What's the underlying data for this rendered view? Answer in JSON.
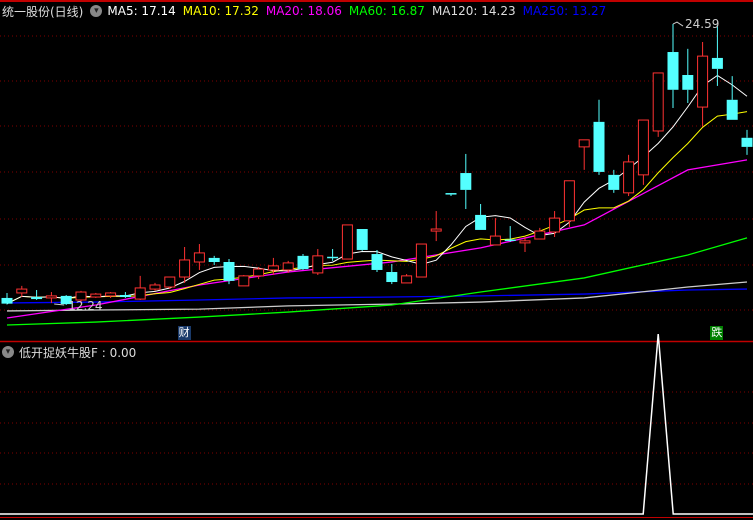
{
  "header": {
    "title": "统一股份(日线)",
    "menu_icon": "chevron-down-circle-icon",
    "ma": [
      {
        "label": "MA5: 17.14",
        "color": "#ffffff"
      },
      {
        "label": "MA10: 17.32",
        "color": "#ffff00"
      },
      {
        "label": "MA20: 18.06",
        "color": "#ff00ff"
      },
      {
        "label": "MA60: 16.87",
        "color": "#00ff00"
      },
      {
        "label": "MA120: 14.23",
        "color": "#dddddd"
      },
      {
        "label": "MA250: 13.27",
        "color": "#0000ff"
      }
    ]
  },
  "indicator": {
    "label": "低开捉妖牛股F : 0.00"
  },
  "markers": {
    "high_label": "24.59",
    "low_label": "12.24",
    "cai": "财",
    "die": "跌"
  },
  "colors": {
    "up": "#ff3232",
    "down": "#54ffff",
    "grid": "#800000",
    "bg": "#000000"
  },
  "chart_data": {
    "type": "candlestick",
    "price_range": [
      11.2,
      25.3
    ],
    "candles": [
      [
        12.55,
        12.77,
        12.26,
        12.3
      ],
      [
        12.77,
        13.08,
        12.59,
        12.94
      ],
      [
        12.59,
        12.9,
        12.46,
        12.5
      ],
      [
        12.55,
        12.81,
        12.33,
        12.64
      ],
      [
        12.64,
        12.68,
        12.24,
        12.28
      ],
      [
        12.46,
        12.86,
        12.3,
        12.81
      ],
      [
        12.59,
        12.77,
        12.55,
        12.72
      ],
      [
        12.64,
        12.81,
        12.55,
        12.77
      ],
      [
        12.68,
        12.81,
        12.55,
        12.59
      ],
      [
        12.5,
        13.52,
        12.46,
        12.99
      ],
      [
        12.94,
        13.21,
        12.86,
        13.12
      ],
      [
        13.03,
        13.47,
        12.94,
        13.47
      ],
      [
        13.47,
        14.79,
        13.21,
        14.22
      ],
      [
        14.13,
        14.92,
        13.78,
        14.53
      ],
      [
        14.31,
        14.4,
        14.0,
        14.13
      ],
      [
        14.13,
        14.26,
        13.16,
        13.3
      ],
      [
        13.08,
        13.56,
        13.08,
        13.52
      ],
      [
        13.52,
        13.91,
        13.38,
        13.82
      ],
      [
        13.78,
        14.31,
        13.56,
        13.96
      ],
      [
        13.78,
        14.18,
        13.65,
        14.09
      ],
      [
        14.4,
        14.48,
        13.78,
        13.82
      ],
      [
        13.65,
        14.7,
        13.56,
        14.4
      ],
      [
        14.36,
        14.7,
        14.18,
        14.33
      ],
      [
        14.26,
        15.76,
        14.26,
        15.76
      ],
      [
        15.58,
        15.58,
        14.62,
        14.66
      ],
      [
        14.48,
        14.66,
        13.69,
        13.78
      ],
      [
        13.69,
        14.04,
        13.16,
        13.25
      ],
      [
        13.21,
        13.6,
        13.21,
        13.52
      ],
      [
        13.47,
        14.92,
        13.47,
        14.92
      ],
      [
        15.49,
        16.37,
        15.05,
        15.58
      ],
      [
        17.16,
        17.16,
        17.03,
        17.14
      ],
      [
        18.04,
        18.88,
        16.46,
        17.3
      ],
      [
        16.2,
        16.68,
        15.54,
        15.54
      ],
      [
        14.88,
        16.06,
        14.88,
        15.27
      ],
      [
        15.12,
        15.71,
        15.01,
        15.08
      ],
      [
        14.97,
        15.23,
        14.57,
        15.06
      ],
      [
        15.14,
        15.63,
        15.14,
        15.49
      ],
      [
        15.45,
        16.37,
        15.23,
        16.06
      ],
      [
        15.94,
        17.7,
        15.67,
        17.7
      ],
      [
        19.19,
        19.5,
        18.18,
        19.5
      ],
      [
        20.29,
        21.26,
        17.96,
        18.09
      ],
      [
        17.96,
        18.18,
        17.17,
        17.3
      ],
      [
        17.17,
        18.84,
        17.03,
        18.53
      ],
      [
        17.96,
        20.37,
        17.52,
        20.37
      ],
      [
        19.89,
        22.44,
        19.63,
        22.44
      ],
      [
        23.36,
        24.59,
        20.9,
        21.7
      ],
      [
        22.35,
        23.5,
        21.12,
        21.7
      ],
      [
        20.94,
        23.8,
        20.07,
        23.18
      ],
      [
        23.1,
        24.55,
        21.87,
        22.62
      ],
      [
        21.26,
        22.3,
        20.38,
        20.38
      ],
      [
        19.59,
        19.94,
        18.84,
        19.19
      ]
    ],
    "ma_long": {
      "sample_index": [
        0,
        6,
        13,
        19,
        26,
        32,
        39,
        46,
        50
      ],
      "MA20": [
        11.67,
        12.24,
        13.12,
        13.69,
        14.13,
        14.75,
        15.76,
        18.18,
        18.62
      ],
      "MA60": [
        11.36,
        11.49,
        11.71,
        11.93,
        12.24,
        12.81,
        13.43,
        14.44,
        15.19
      ],
      "MA120": [
        11.98,
        12.02,
        12.06,
        12.2,
        12.28,
        12.37,
        12.55,
        13.03,
        13.25
      ],
      "MA250": [
        12.33,
        12.37,
        12.46,
        12.55,
        12.59,
        12.64,
        12.72,
        12.9,
        12.94
      ]
    },
    "indicator_values_range": [
      0,
      1
    ],
    "indicator_signal_index": 44,
    "high_index": 45,
    "low_index": 4,
    "cai_index": 12,
    "die_index": 48
  }
}
